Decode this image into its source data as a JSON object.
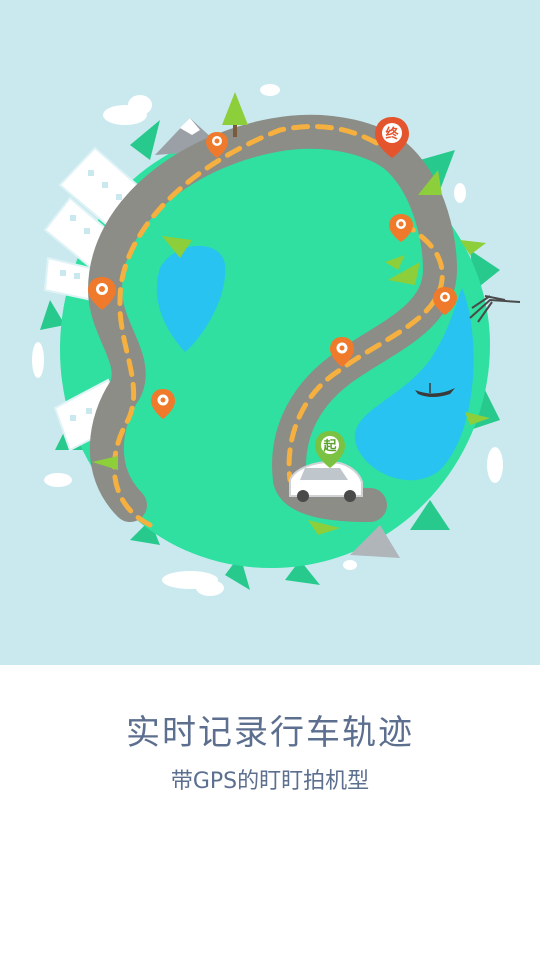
{
  "onboarding": {
    "headline": "实时记录行车轨迹",
    "subline": "带GPS的盯盯拍机型"
  },
  "illustration": {
    "start_pin_label": "起",
    "end_pin_label": "终",
    "icons": [
      "globe-icon",
      "car-icon",
      "camera-pin-icon",
      "start-pin-icon",
      "end-pin-icon",
      "eiffel-tower-icon",
      "boat-icon",
      "tree-icon",
      "cloud-icon",
      "building-icon",
      "mountain-icon",
      "lake-icon"
    ]
  },
  "colors": {
    "sky": "#c9e9ef",
    "globe": "#2fe0a0",
    "road": "#8b8d86",
    "route": "#f5b040",
    "camera_pin": "#f07a2c",
    "start_pin": "#7cc242",
    "end_pin": "#e4552e",
    "water": "#28c3f0",
    "text": "#5d6f8f"
  }
}
